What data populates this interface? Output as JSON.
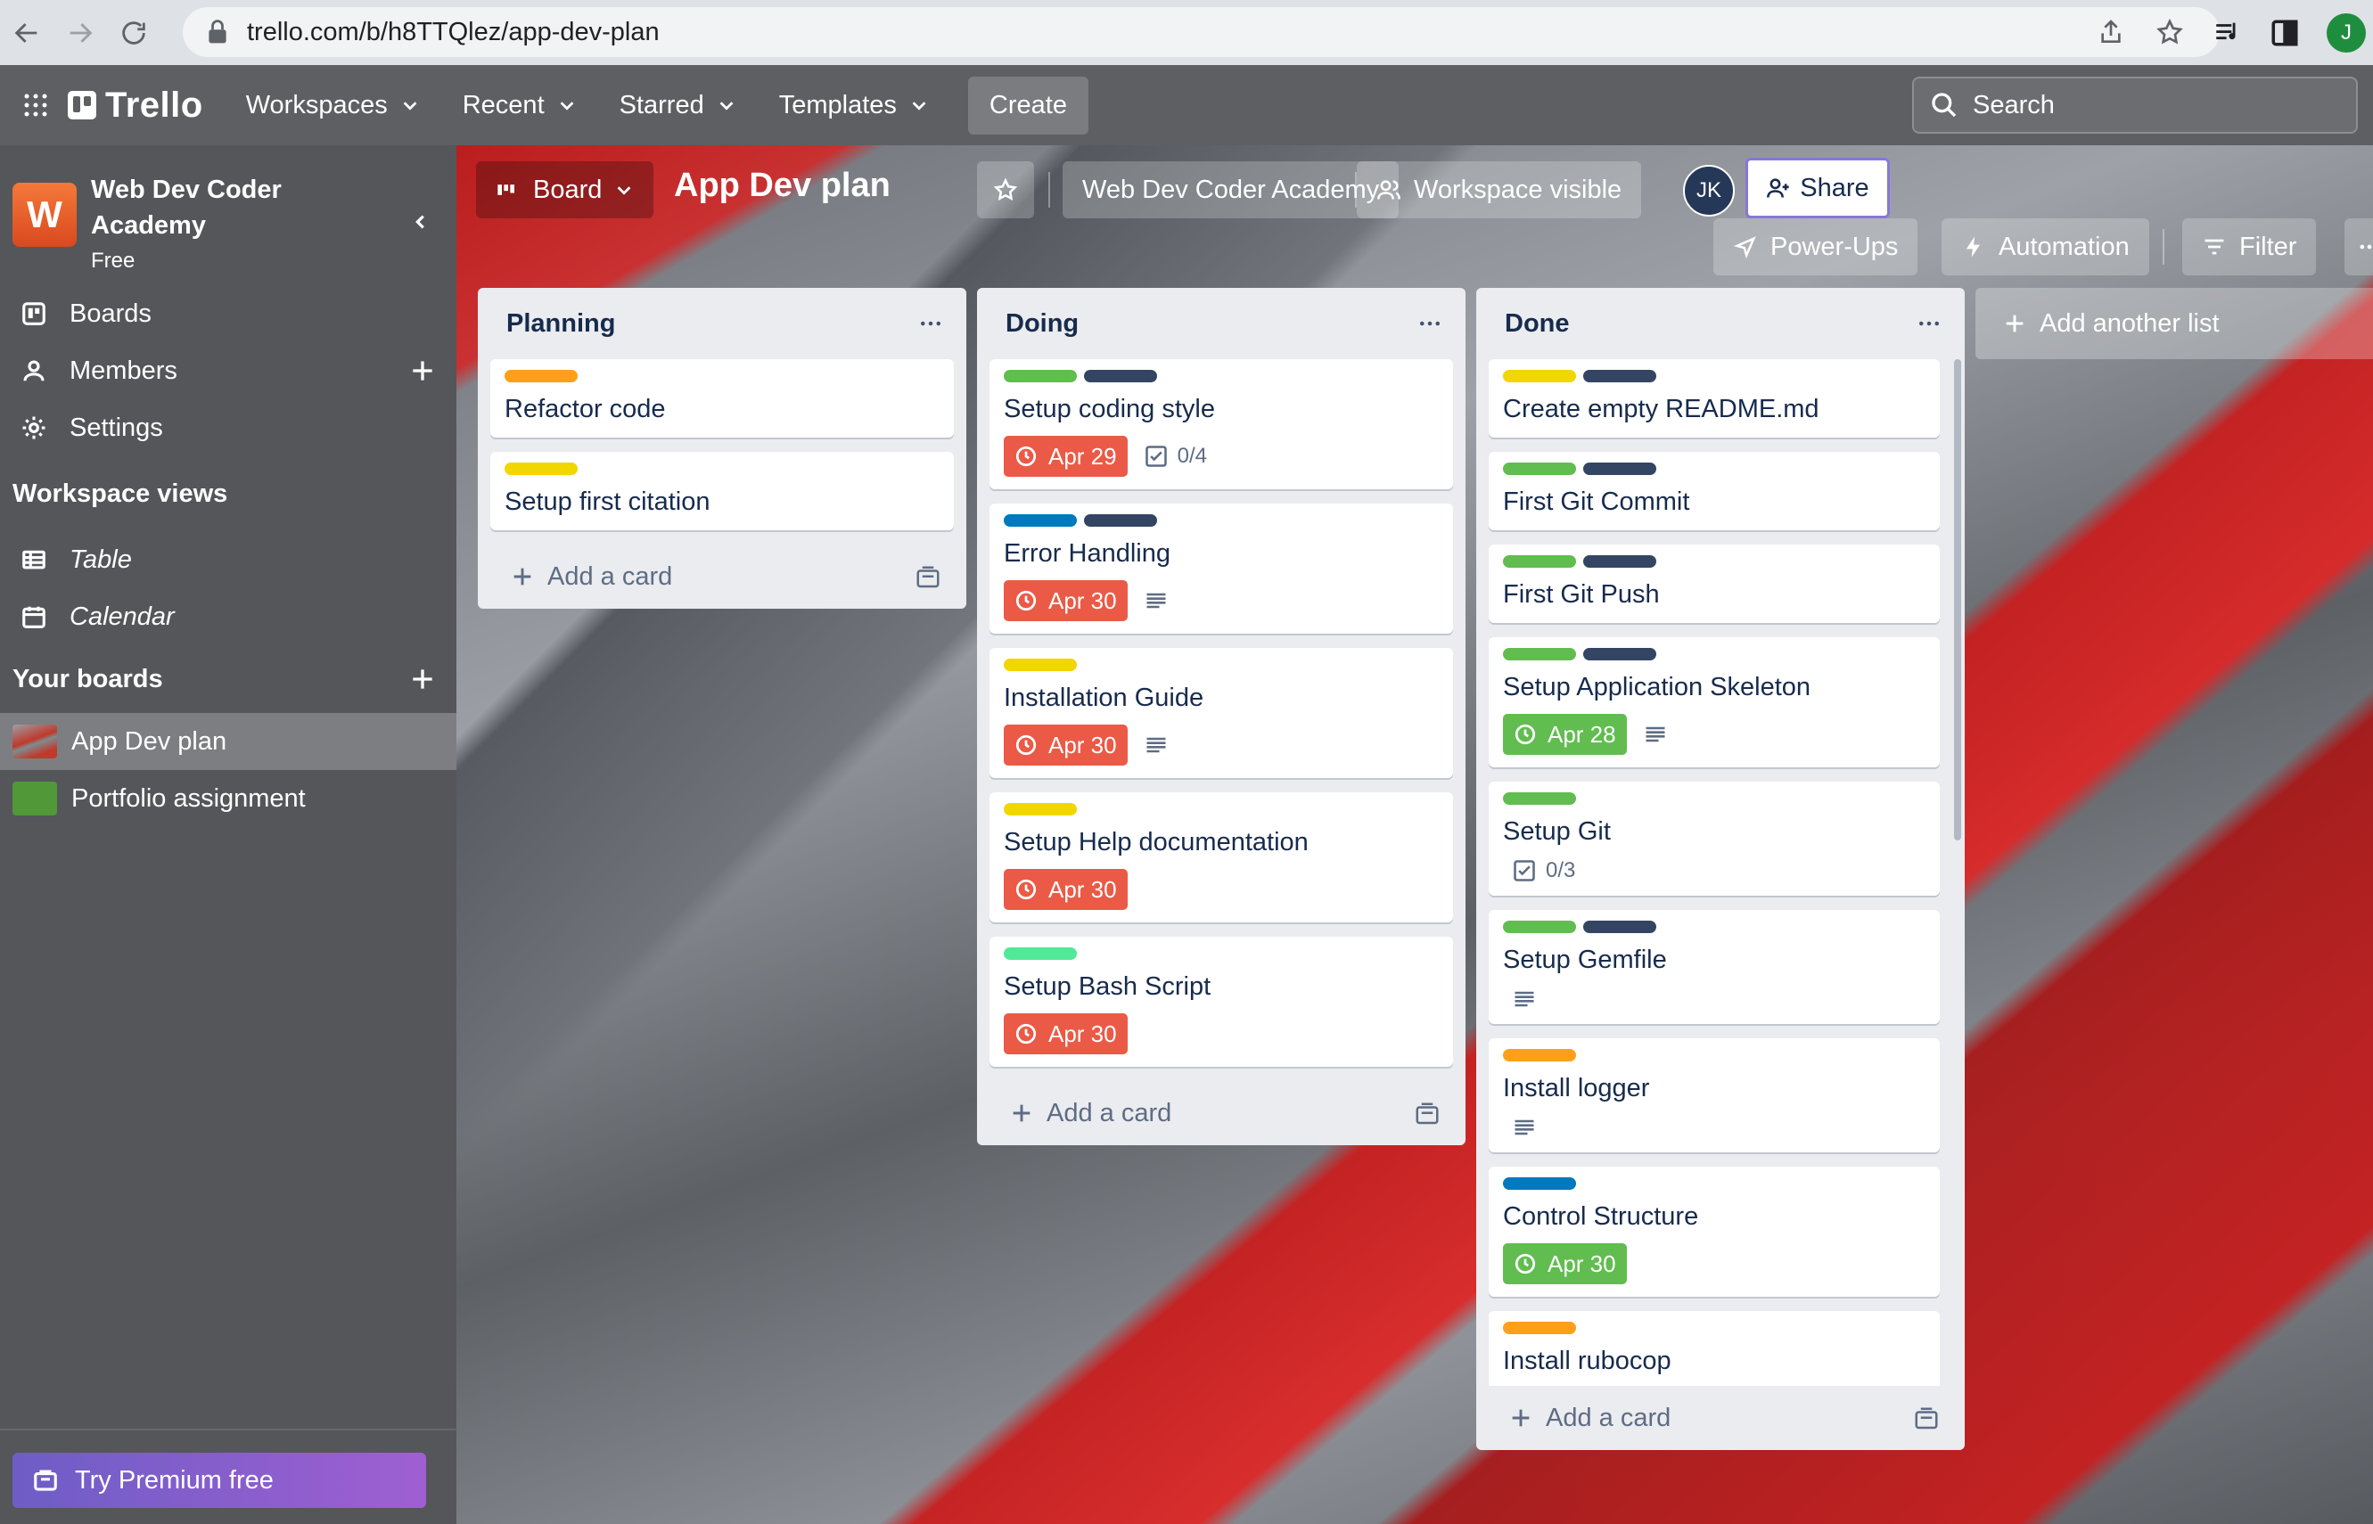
{
  "browser": {
    "url": "trello.com/b/h8TTQlez/app-dev-plan",
    "profile_initial": "J"
  },
  "header": {
    "logo": "Trello",
    "menu": [
      {
        "label": "Workspaces"
      },
      {
        "label": "Recent"
      },
      {
        "label": "Starred"
      },
      {
        "label": "Templates"
      }
    ],
    "create_label": "Create",
    "search_placeholder": "Search"
  },
  "sidebar": {
    "workspace_initial": "W",
    "workspace_name": "Web Dev Coder Academy",
    "workspace_plan": "Free",
    "items": [
      {
        "label": "Boards",
        "icon": "board-icon"
      },
      {
        "label": "Members",
        "icon": "person-icon"
      },
      {
        "label": "Settings",
        "icon": "gear-icon"
      }
    ],
    "views_heading": "Workspace views",
    "views": [
      {
        "label": "Table",
        "icon": "table-icon"
      },
      {
        "label": "Calendar",
        "icon": "calendar-icon"
      }
    ],
    "boards_heading": "Your boards",
    "boards": [
      {
        "label": "App Dev plan",
        "active": true
      },
      {
        "label": "Portfolio assignment",
        "active": false
      }
    ],
    "premium_label": "Try Premium free"
  },
  "board_header": {
    "view_label": "Board",
    "title": "App Dev plan",
    "workspace_label": "Web Dev Coder Academy",
    "visibility_label": "Workspace visible",
    "member_initials": "JK",
    "share_label": "Share",
    "powerups_label": "Power-Ups",
    "automation_label": "Automation",
    "filter_label": "Filter"
  },
  "lists": [
    {
      "title": "Planning",
      "cards": [
        {
          "labels": [
            "#ff9f1a"
          ],
          "title": "Refactor code"
        },
        {
          "labels": [
            "#f2d600"
          ],
          "title": "Setup first citation"
        }
      ],
      "add_card_label": "Add a card"
    },
    {
      "title": "Doing",
      "cards": [
        {
          "labels": [
            "#61bd4f",
            "#344563"
          ],
          "title": "Setup coding style",
          "due": "Apr 29",
          "checklist": "0/4"
        },
        {
          "labels": [
            "#0079bf",
            "#344563"
          ],
          "title": "Error Handling",
          "due": "Apr 30",
          "description": true
        },
        {
          "labels": [
            "#f2d600"
          ],
          "title": "Installation Guide",
          "due": "Apr 30",
          "description": true
        },
        {
          "labels": [
            "#f2d600"
          ],
          "title": "Setup Help documentation",
          "due": "Apr 30"
        },
        {
          "labels": [
            "#51e898"
          ],
          "title": "Setup Bash Script",
          "due": "Apr 30"
        }
      ],
      "add_card_label": "Add a card"
    },
    {
      "title": "Done",
      "cards": [
        {
          "labels": [
            "#f2d600",
            "#344563"
          ],
          "title": "Create empty README.md"
        },
        {
          "labels": [
            "#61bd4f",
            "#344563"
          ],
          "title": "First Git Commit"
        },
        {
          "labels": [
            "#61bd4f",
            "#344563"
          ],
          "title": "First Git Push"
        },
        {
          "labels": [
            "#61bd4f",
            "#344563"
          ],
          "title": "Setup Application Skeleton",
          "due": "Apr 28",
          "description": true
        },
        {
          "labels": [
            "#61bd4f"
          ],
          "title": "Setup Git",
          "checklist": "0/3"
        },
        {
          "labels": [
            "#61bd4f",
            "#344563"
          ],
          "title": "Setup Gemfile",
          "description": true
        },
        {
          "labels": [
            "#ff9f1a"
          ],
          "title": "Install logger",
          "description": true
        },
        {
          "labels": [
            "#0079bf"
          ],
          "title": "Control Structure",
          "due": "Apr 30"
        },
        {
          "labels": [
            "#ff9f1a"
          ],
          "title": "Install rubocop"
        }
      ],
      "add_card_label": "Add a card"
    }
  ],
  "add_list_label": "Add another list"
}
